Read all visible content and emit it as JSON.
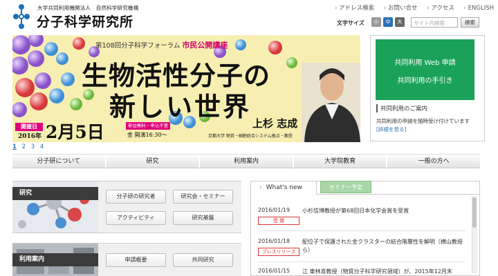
{
  "header": {
    "org_top": "大学共同利用機関法人　自然科学研究機構",
    "org_name": "分子科学研究所",
    "top_links": [
      "アドレス検索",
      "お問い合せ",
      "アクセス",
      "ENGLISH"
    ],
    "font_size_label": "文字サイズ",
    "font_sizes": [
      "小",
      "中",
      "大"
    ],
    "search_placeholder": "サイト内検索",
    "search_button": "検索"
  },
  "banner": {
    "line1_prefix": "第108回分子科学フォーラム",
    "line1_highlight": "市民公開講座",
    "title_line1": "生物活性分子の",
    "title_line2": "新しい世界",
    "open_label": "開催日",
    "year": "2016年",
    "date": "2月5日",
    "free_label": "参加無料・申込不要",
    "time": "金 開演16:30～",
    "speaker": "上杉 志成",
    "affiliation": "京都大学 物質－細胞統合システム拠点・教授"
  },
  "pager": [
    "1",
    "2",
    "3",
    "4"
  ],
  "side_panel": {
    "link1": "共同利用 Web 申請",
    "link2": "共同利用の手引き",
    "notice_title": "共同利用のご案内",
    "notice_body": "共同利用の申請を随時受け付けています",
    "notice_link": "[詳細を見る]"
  },
  "nav": [
    "分子研について",
    "研究",
    "利用案内",
    "大学院教育",
    "一般の方へ"
  ],
  "sections": [
    {
      "label": "研究",
      "buttons": [
        "分子研の研究者",
        "研究会・セミナー",
        "アクティビティ",
        "研究基盤"
      ]
    },
    {
      "label": "利用案内",
      "buttons": [
        "申請概要",
        "共同研究"
      ]
    }
  ],
  "news": {
    "tab_active": "What's new",
    "tab_inactive": "セミナー予定",
    "items": [
      {
        "date": "2016/01/19",
        "text": "小杉信博教授が第68回日本化学会賞を受賞",
        "tag": "受 賞"
      },
      {
        "date": "2016/01/18",
        "text": "配位子で保護された金クラスターの結合階層性を解明（横山教授ら）",
        "tag": "プレスリリース"
      },
      {
        "date": "2016/01/15",
        "text": "江 東林准教授（物質分子科学研究領域）が、2015年12月末",
        "tag": ""
      }
    ]
  },
  "colors": {
    "accent_green": "#1aa259",
    "banner_bg": "#f7efb2",
    "highlight_pink": "#e0007b",
    "tab_green": "#a8d6a6"
  },
  "icons": [
    "molecule-logo-icon"
  ]
}
